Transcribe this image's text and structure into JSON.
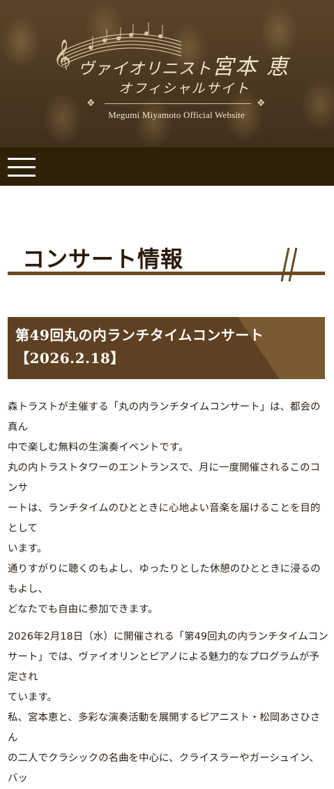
{
  "header": {
    "title_pre": "ヴァイオリニスト",
    "title_name": "宮本 恵",
    "subtitle": "オフィシャルサイト",
    "title_en": "Megumi Miyamoto Official Website"
  },
  "nav": {
    "menu_icon": "hamburger-menu-icon"
  },
  "section": {
    "heading": "コンサート情報"
  },
  "event": {
    "title_line1": "第49回丸の内ランチタイムコンサート",
    "title_line2": "【2026.2.18】"
  },
  "content": {
    "lines": [
      "森トラストが主催する「丸の内ランチタイムコンサート」は、都会の真ん",
      "中で楽しむ無料の生演奏イベントです。",
      "丸の内トラストタワーのエントランスで、月に一度開催されるこのコンサ",
      "ートは、ランチタイムのひとときに心地よい音楽を届けることを目的として",
      "います。",
      "通りすがりに聴くのもよし、ゆったりとした休憩のひとときに浸るのもよし、",
      "どなたでも自由に参加できます。",
      "2026年2月18日（水）に開催される「第49回丸の内ランチタイムコン",
      "サート」では、ヴァイオリンとピアノによる魅力的なプログラムが予定され",
      "ています。",
      "私、宮本恵と、多彩な演奏活動を展開するピアニスト・松岡あさひさん",
      "の二人でクラシックの名曲を中心に、クライスラーやガーシュイン、バッ"
    ]
  }
}
